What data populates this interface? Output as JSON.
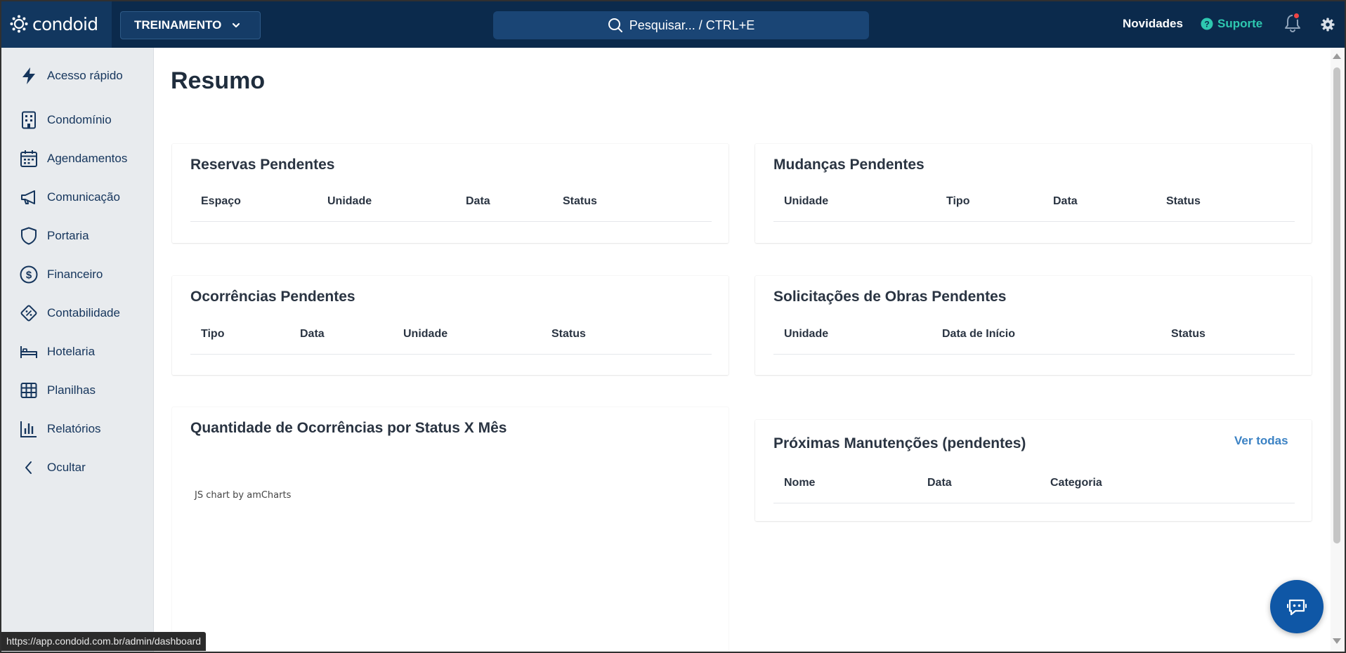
{
  "topbar": {
    "brand": "condoid",
    "environment": "TREINAMENTO",
    "search_placeholder": "Pesquisar... / CTRL+E",
    "news": "Novidades",
    "support": "Suporte"
  },
  "sidebar": {
    "items": [
      {
        "label": "Acesso rápido",
        "icon": "bolt-icon"
      },
      {
        "label": "Condomínio",
        "icon": "building-icon"
      },
      {
        "label": "Agendamentos",
        "icon": "calendar-icon"
      },
      {
        "label": "Comunicação",
        "icon": "megaphone-icon"
      },
      {
        "label": "Portaria",
        "icon": "shield-icon"
      },
      {
        "label": "Financeiro",
        "icon": "dollar-icon"
      },
      {
        "label": "Contabilidade",
        "icon": "percent-tag-icon"
      },
      {
        "label": "Hotelaria",
        "icon": "bed-icon"
      },
      {
        "label": "Planilhas",
        "icon": "grid-icon"
      },
      {
        "label": "Relatórios",
        "icon": "bar-chart-icon"
      },
      {
        "label": "Ocultar",
        "icon": "chevron-left-icon"
      }
    ]
  },
  "main": {
    "title": "Resumo",
    "reservas": {
      "title": "Reservas Pendentes",
      "columns": [
        "Espaço",
        "Unidade",
        "Data",
        "Status"
      ]
    },
    "mudancas": {
      "title": "Mudanças Pendentes",
      "columns": [
        "Unidade",
        "Tipo",
        "Data",
        "Status"
      ]
    },
    "ocorrencias": {
      "title": "Ocorrências Pendentes",
      "columns": [
        "Tipo",
        "Data",
        "Unidade",
        "Status"
      ]
    },
    "obras": {
      "title": "Solicitações de Obras Pendentes",
      "columns": [
        "Unidade",
        "Data de Início",
        "Status"
      ]
    },
    "grafico": {
      "title": "Quantidade de Ocorrências por Status X Mês",
      "credit": "JS chart by amCharts"
    },
    "manutencoes": {
      "title": "Próximas Manutenções (pendentes)",
      "link": "Ver todas",
      "columns": [
        "Nome",
        "Data",
        "Categoria"
      ]
    }
  },
  "statusbar": {
    "url": "https://app.condoid.com.br/admin/dashboard"
  },
  "colors": {
    "topbar": "#0b2a4c",
    "accent": "#0f57a6",
    "support": "#2ec8b0",
    "link": "#3b82c4"
  }
}
